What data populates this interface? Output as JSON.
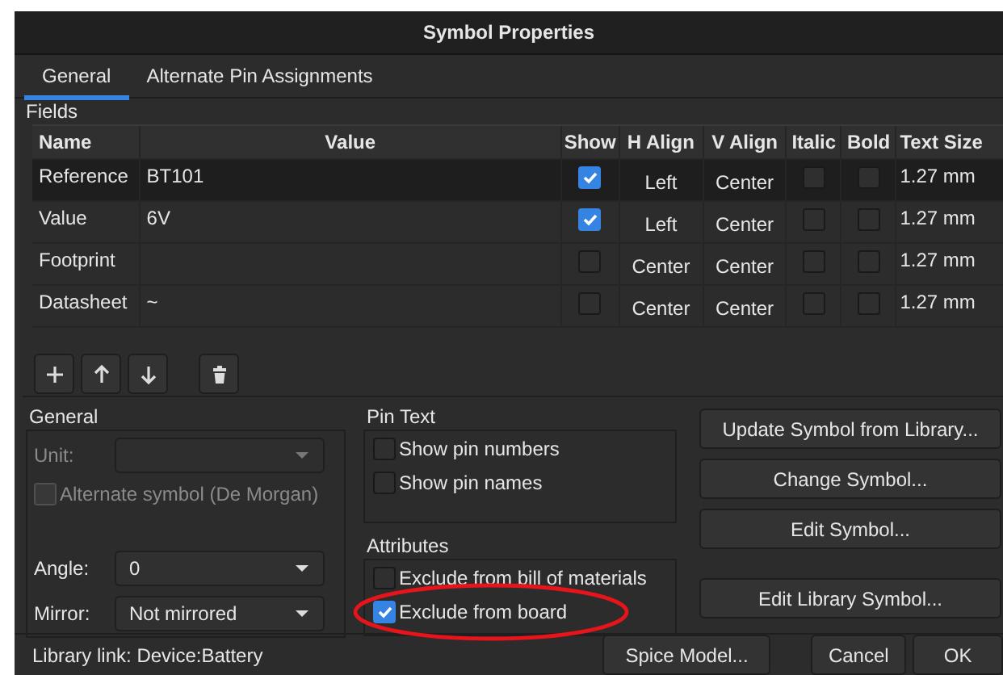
{
  "window": {
    "title": "Symbol Properties"
  },
  "tabs": [
    {
      "label": "General",
      "selected": true
    },
    {
      "label": "Alternate Pin Assignments",
      "selected": false
    }
  ],
  "fields": {
    "label": "Fields",
    "columns": [
      "Name",
      "Value",
      "Show",
      "H Align",
      "V Align",
      "Italic",
      "Bold",
      "Text Size"
    ],
    "rows": [
      {
        "name": "Reference",
        "value": "BT101",
        "show": true,
        "h_align": "Left",
        "v_align": "Center",
        "italic": false,
        "bold": false,
        "text_size": "1.27 mm",
        "selected": true
      },
      {
        "name": "Value",
        "value": "6V",
        "show": true,
        "h_align": "Left",
        "v_align": "Center",
        "italic": false,
        "bold": false,
        "text_size": "1.27 mm",
        "selected": false
      },
      {
        "name": "Footprint",
        "show": false,
        "h_align": "Center",
        "v_align": "Center",
        "italic": false,
        "bold": false,
        "text_size": "1.27 mm",
        "selected": false
      },
      {
        "name": "Datasheet",
        "value": "~",
        "show": false,
        "h_align": "Center",
        "v_align": "Center",
        "italic": false,
        "bold": false,
        "text_size": "1.27 mm",
        "selected": false
      }
    ],
    "tools": [
      {
        "kind": "add"
      },
      {
        "kind": "up"
      },
      {
        "kind": "down"
      },
      {
        "kind": "delete"
      }
    ]
  },
  "general": {
    "label": "General",
    "unit": {
      "label": "Unit:",
      "disabled": true
    },
    "alternate_symbol": {
      "label": "Alternate symbol (De Morgan)",
      "checked": false,
      "disabled": true
    },
    "angle": {
      "label": "Angle:",
      "value": "0"
    },
    "mirror": {
      "label": "Mirror:",
      "value": "Not mirrored"
    }
  },
  "pin_text": {
    "label": "Pin Text",
    "options": [
      {
        "label": "Show pin numbers",
        "checked": false
      },
      {
        "label": "Show pin names",
        "checked": false
      }
    ]
  },
  "attributes": {
    "label": "Attributes",
    "options": [
      {
        "label": "Exclude from bill of materials",
        "checked": false,
        "highlighted": false
      },
      {
        "label": "Exclude from board",
        "checked": true,
        "highlighted": true
      }
    ]
  },
  "actions": [
    "Update Symbol from Library...",
    "Change Symbol...",
    "Edit Symbol...",
    "Edit Library Symbol..."
  ],
  "library_link": "Library link: Device:Battery",
  "footer_buttons": [
    "Spice Model...",
    "Cancel",
    "OK"
  ]
}
